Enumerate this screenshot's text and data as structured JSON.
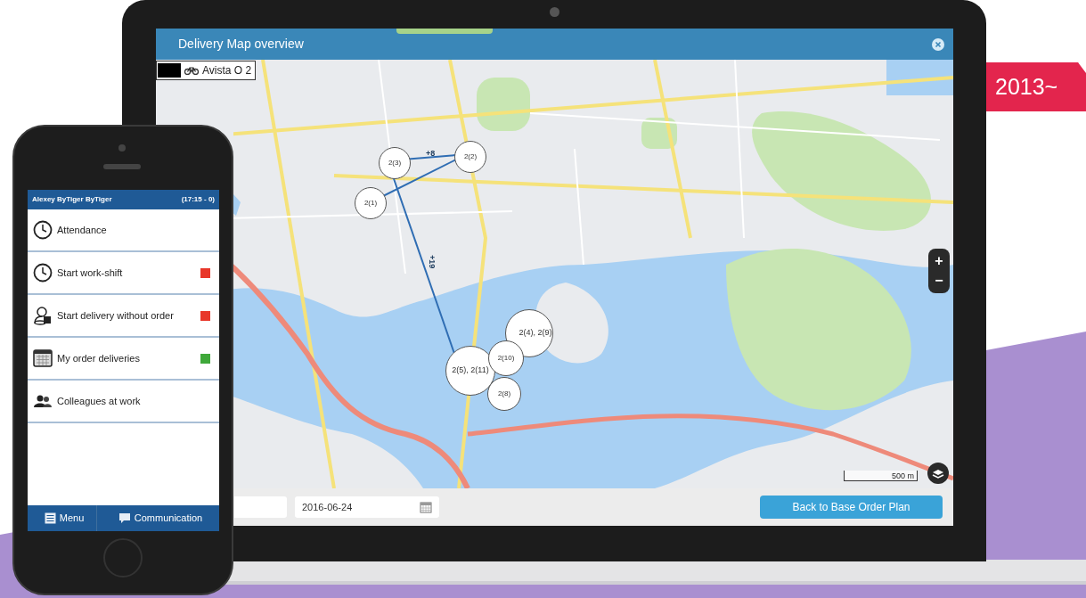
{
  "badge": {
    "label": "2013~"
  },
  "laptop": {
    "window": {
      "title": "Delivery Map overview"
    },
    "legend": {
      "label": "Avista O 2"
    },
    "map": {
      "markers": [
        {
          "label": "2(3)"
        },
        {
          "label": "2(2)"
        },
        {
          "label": "2(1)"
        },
        {
          "label": "2(4), 2(9)"
        },
        {
          "label": "2(5), 2(11)"
        },
        {
          "label": "2(10)"
        },
        {
          "label": "2(8)"
        }
      ],
      "route_labels": [
        "+8",
        "+19"
      ],
      "zoom_controls": [
        "+",
        "−"
      ],
      "scale": "500 m"
    },
    "bottom_bar": {
      "date_field": {
        "value": "2016-06-24"
      },
      "button": "Back to Base Order Plan"
    }
  },
  "phone": {
    "status_bar": {
      "user": "Alexey ByTiger ByTiger",
      "time": "(17:15 - 0)"
    },
    "menu_items": [
      {
        "label": "Attendance"
      },
      {
        "label": "Start work-shift",
        "color": "#e8372a"
      },
      {
        "label": "Start delivery without order",
        "color": "#e8372a"
      },
      {
        "label": "My order deliveries",
        "color": "#3fa83a"
      },
      {
        "label": "Colleagues at work"
      }
    ],
    "footer": [
      {
        "label": "Menu"
      },
      {
        "label": "Communication"
      }
    ]
  }
}
